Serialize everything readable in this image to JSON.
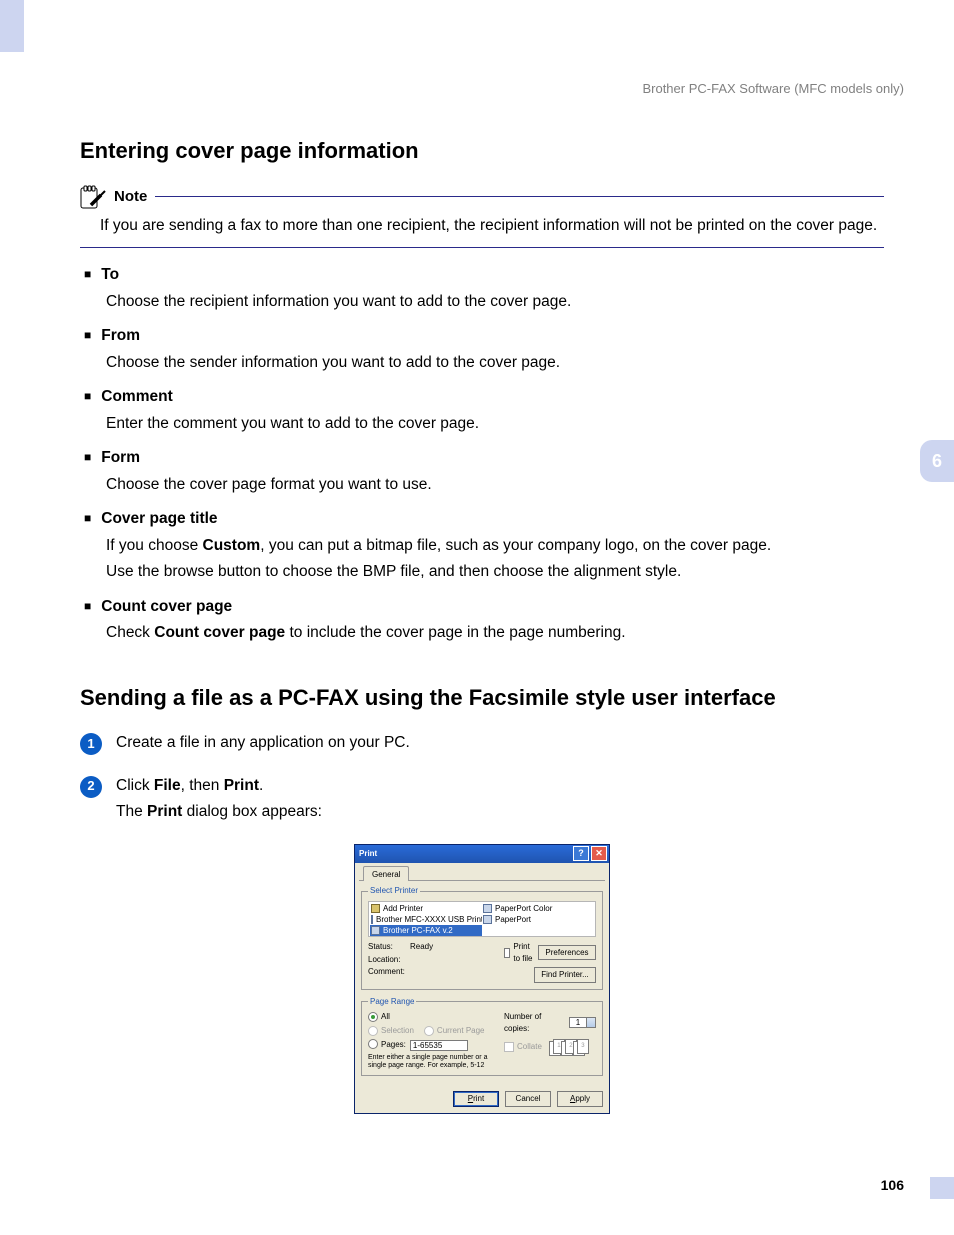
{
  "header": "Brother PC-FAX Software (MFC models only)",
  "sideTab": "6",
  "pageNumber": "106",
  "section1": {
    "title": "Entering cover page information",
    "note": {
      "label": "Note",
      "body": "If you are sending a fax to more than one recipient, the recipient information will not be printed on the cover page."
    },
    "items": [
      {
        "head": "To",
        "body": "Choose the recipient information you want to add to the cover page."
      },
      {
        "head": "From",
        "body": "Choose the sender information you want to add to the cover page."
      },
      {
        "head": "Comment",
        "body": "Enter the comment you want to add to the cover page."
      },
      {
        "head": "Form",
        "body": "Choose the cover page format you want to use."
      }
    ],
    "coverTitle": {
      "head": "Cover page title",
      "line1_a": "If you choose ",
      "line1_b": "Custom",
      "line1_c": ", you can put a bitmap file, such as your company logo, on the cover page.",
      "line2": "Use the browse button to choose the BMP file, and then choose the alignment style."
    },
    "countCover": {
      "head": "Count cover page",
      "a": "Check ",
      "b": "Count cover page",
      "c": " to include the cover page in the page numbering."
    }
  },
  "section2": {
    "title": "Sending a file as a PC-FAX using the Facsimile style user interface",
    "steps": {
      "s1": {
        "num": "1",
        "text": "Create a file in any application on your PC."
      },
      "s2": {
        "num": "2",
        "a": "Click ",
        "b": "File",
        "c": ", then ",
        "d": "Print",
        "e": ".",
        "l2a": "The ",
        "l2b": "Print",
        "l2c": " dialog box appears:"
      }
    }
  },
  "dialog": {
    "title": "Print",
    "tab": "General",
    "selectPrinter": "Select Printer",
    "printers": {
      "p1": "Add Printer",
      "p2": "PaperPort Color",
      "p3": "Brother MFC-XXXX USB Printer",
      "p4": "PaperPort",
      "p5": "Brother PC-FAX v.2"
    },
    "status": {
      "statusLbl": "Status:",
      "statusVal": "Ready",
      "locationLbl": "Location:",
      "commentLbl": "Comment:"
    },
    "printToFile": "Print to file",
    "preferences": "Preferences",
    "findPrinter": "Find Printer...",
    "pageRange": "Page Range",
    "all": "All",
    "selection": "Selection",
    "currentPage": "Current Page",
    "pages": "Pages:",
    "pagesVal": "1-65535",
    "hint": "Enter either a single page number or a single page range. For example, 5-12",
    "copiesLbl": "Number of copies:",
    "copiesVal": "1",
    "collate": "Collate",
    "collateStack": {
      "a": "1",
      "b": "2",
      "c": "3"
    },
    "btnPrint": "Print",
    "btnCancel": "Cancel",
    "btnApply": "Apply"
  }
}
